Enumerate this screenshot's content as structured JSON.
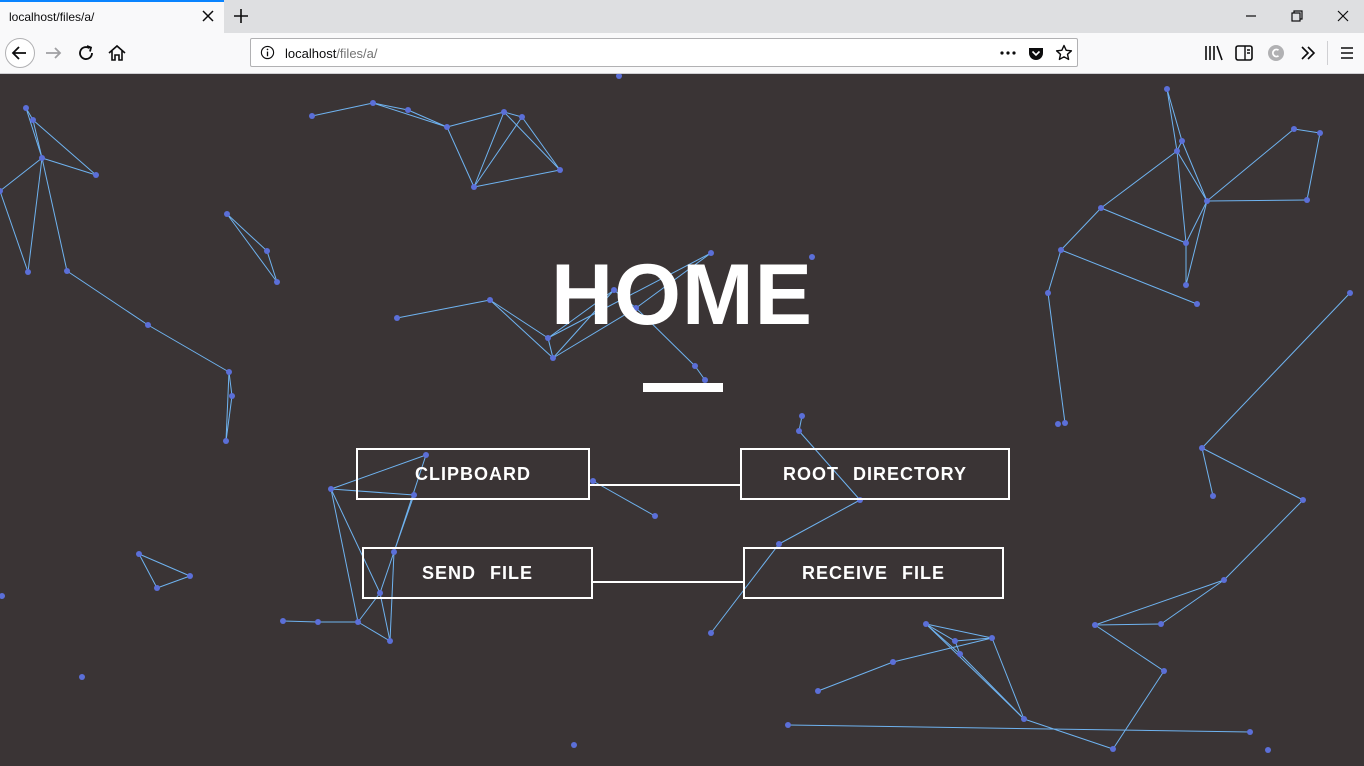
{
  "browser": {
    "tab_title": "localhost/files/a/",
    "url_host": "localhost",
    "url_path": "/files/a/"
  },
  "page": {
    "title": "HOME",
    "buttons": {
      "clipboard": "CLIPBOARD",
      "root_directory": "ROOT DIRECTORY",
      "send_file": "SEND FILE",
      "receive_file": "RECEIVE FILE"
    }
  },
  "colors": {
    "background": "#3a3435",
    "particle": "#5b6fd8",
    "link": "#6fb3f0",
    "text": "#ffffff"
  }
}
